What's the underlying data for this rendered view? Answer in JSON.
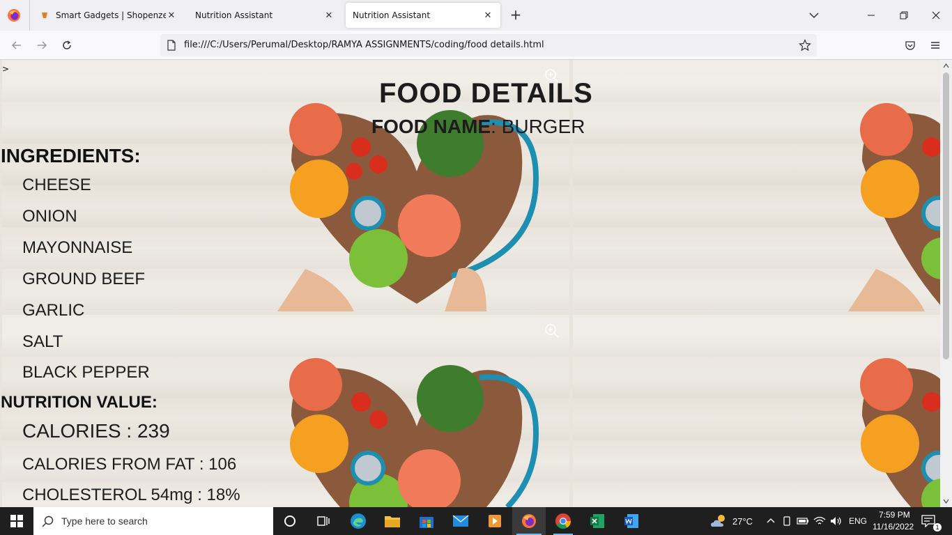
{
  "browser": {
    "tabs": [
      {
        "title": "Smart Gadgets | Shopenzer, Inc.",
        "active": false
      },
      {
        "title": "Nutrition Assistant",
        "active": false
      },
      {
        "title": "Nutrition Assistant",
        "active": true
      }
    ],
    "url": "file:///C:/Users/Perumal/Desktop/RAMYA ASSIGNMENTS/coding/food details.html"
  },
  "page": {
    "caret": ">",
    "title": "FOOD DETAILS",
    "food_name_label": "FOOD NAME",
    "food_name_value": ": BURGER",
    "ingredients_heading": "INGREDIENTS:",
    "ingredients": [
      "CHEESE",
      "ONION",
      "MAYONNAISE",
      "GROUND BEEF",
      "GARLIC",
      "SALT",
      "BLACK PEPPER"
    ],
    "nutrition_heading": "NUTRITION VALUE:",
    "nutrition": [
      "CALORIES : 239",
      "CALORIES FROM FAT : 106",
      "CHOLESTEROL 54mg : 18%"
    ]
  },
  "taskbar": {
    "search_placeholder": "Type here to search",
    "weather": "27°C",
    "language": "ENG",
    "time": "7:59 PM",
    "date": "11/16/2022",
    "notification_count": "1"
  },
  "colors": {
    "accent": "#76b9ed",
    "taskbar": "#1f1f1f"
  }
}
